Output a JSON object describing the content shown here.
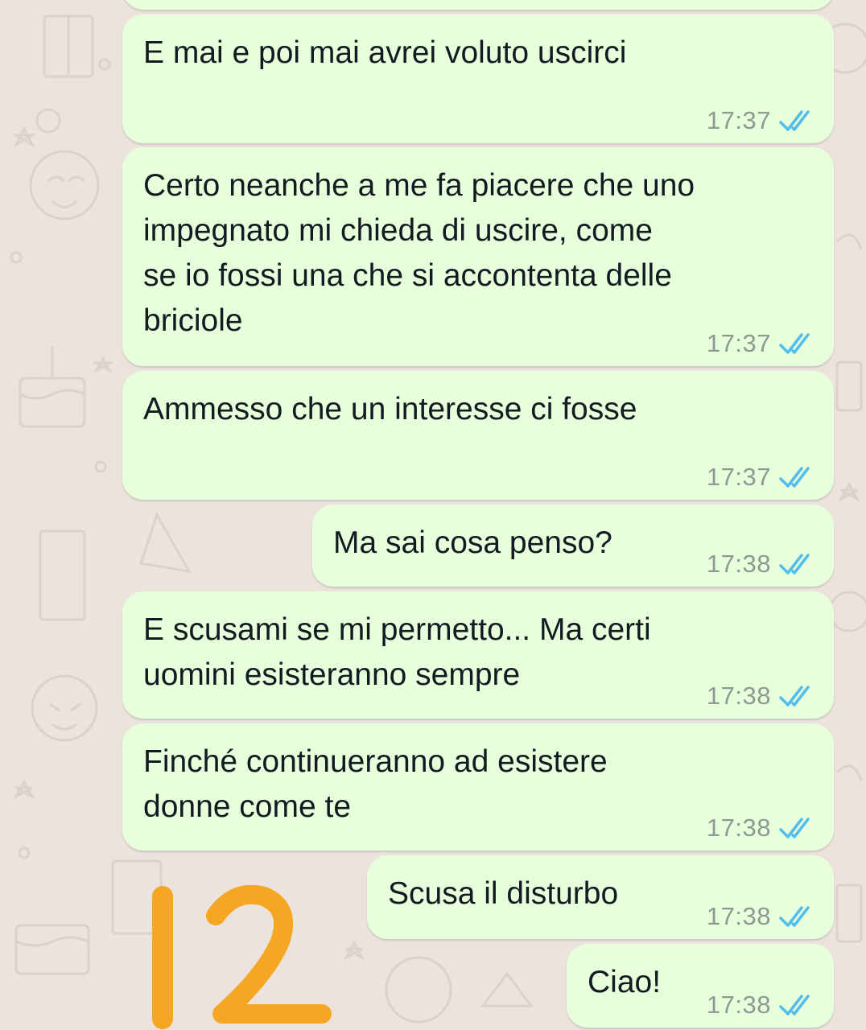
{
  "colors": {
    "bubble_bg": "#e7ffdb",
    "chat_bg": "#ebe3dc",
    "read_tick": "#53bdeb",
    "time_text": "#8c9a93",
    "annotation": "#f5a623"
  },
  "icons": {
    "read_receipt": "double-check-icon"
  },
  "messages": [
    {
      "text": "E mai e poi mai avrei voluto uscirci",
      "time": "17:37",
      "status": "read"
    },
    {
      "text": "Certo neanche a me fa piacere che uno\nimpegnato mi chieda di uscire, come\nse io fossi una che si accontenta delle\nbriciole",
      "time": "17:37",
      "status": "read"
    },
    {
      "text": "Ammesso che un interesse ci fosse",
      "time": "17:37",
      "status": "read"
    },
    {
      "text": "Ma sai cosa penso?",
      "time": "17:38",
      "status": "read"
    },
    {
      "text": "E scusami se mi permetto... Ma certi\nuomini esisteranno sempre",
      "time": "17:38",
      "status": "read"
    },
    {
      "text": "Finché continueranno ad esistere\ndonne come te",
      "time": "17:38",
      "status": "read"
    },
    {
      "text": "Scusa il disturbo",
      "time": "17:38",
      "status": "read"
    },
    {
      "text": "Ciao!",
      "time": "17:38",
      "status": "read"
    }
  ],
  "annotation": {
    "text": "12"
  }
}
